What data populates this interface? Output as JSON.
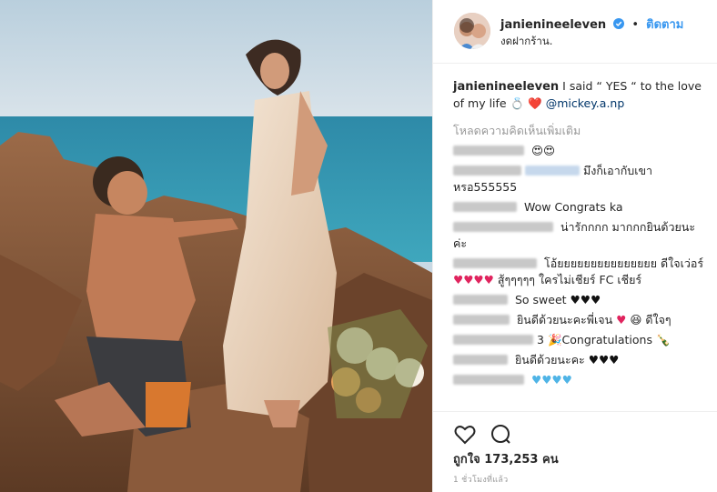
{
  "post": {
    "username": "janienineeleven",
    "follow_label": "ติดตาม",
    "dot": "•",
    "location": "งดฝากร้าน."
  },
  "caption": {
    "username": "janienineeleven",
    "text": "I said “ YES “ to the love of my life",
    "emoji": "💍 ❤️",
    "mention": "@mickey.a.np"
  },
  "load_more": "โหลดความคิดเห็นเพิ่มเติม",
  "comments": [
    {
      "text": "😍😍"
    },
    {
      "text": "มึงก็เอากับเขาหรอ555555"
    },
    {
      "text": "Wow Congrats ka"
    },
    {
      "text": "น่ารักกกก มากกกยินด้วยนะค่ะ"
    },
    {
      "text": "โอ้ยยยยยยยยยยยยยยย ดีใจเว่อร์"
    },
    {
      "text": "สู้ๆๆๆๆๆ ใครไม่เชียร์ FC เชียร์"
    },
    {
      "text": "So sweet"
    },
    {
      "text": "ยินดีด้วยนะคะพี่เจน"
    },
    {
      "text": "ดีใจๆ"
    },
    {
      "text": "3"
    },
    {
      "text": "Congratulations"
    },
    {
      "text": "ยินดีด้วยนะคะ"
    }
  ],
  "likes": {
    "prefix": "ถูกใจ",
    "count": "173,253",
    "suffix": "คน"
  },
  "time": "1 ชั่วโมงที่แล้ว",
  "colors": {
    "link": "#3897f0",
    "heart": "#e0245e",
    "blue_heart": "#4fb4e6"
  }
}
